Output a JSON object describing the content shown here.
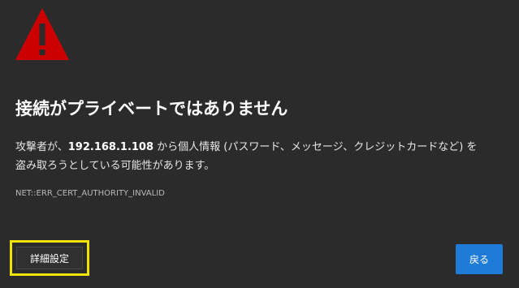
{
  "icon": {
    "name": "warning-triangle-icon",
    "color": "#cc0000"
  },
  "title": "接続がプライベートではありません",
  "message": {
    "before": "攻撃者が、",
    "host": "192.168.1.108",
    "line1_after": " から個人情報 (パスワード、メッセージ、クレジットカードなど) を",
    "line2": "盗み取ろうとしている可能性があります。"
  },
  "error_code": "NET::ERR_CERT_AUTHORITY_INVALID",
  "buttons": {
    "advanced": "詳細設定",
    "back": "戻る"
  },
  "colors": {
    "background": "#2b2b2b",
    "primary_button": "#1f7bd8",
    "focus_outline": "#f2e200"
  }
}
